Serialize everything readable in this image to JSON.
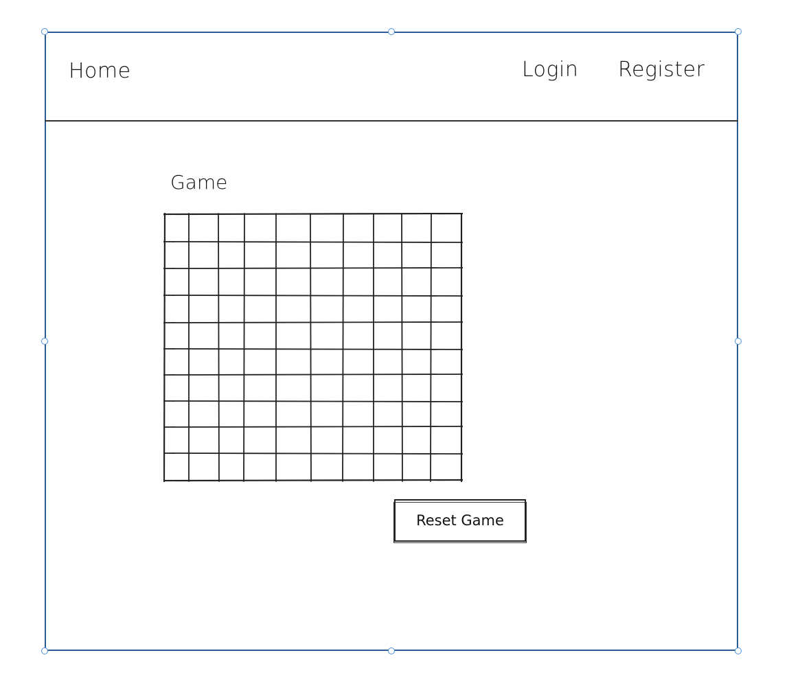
{
  "nav": {
    "home_label": "Home",
    "login_label": "Login",
    "register_label": "Register"
  },
  "main": {
    "title": "Game",
    "board": {
      "rows": 10,
      "cols": 10
    },
    "reset_label": "Reset Game"
  },
  "colors": {
    "frame": "#2b5b94",
    "handle": "#4a90d9",
    "ink": "#222222"
  }
}
